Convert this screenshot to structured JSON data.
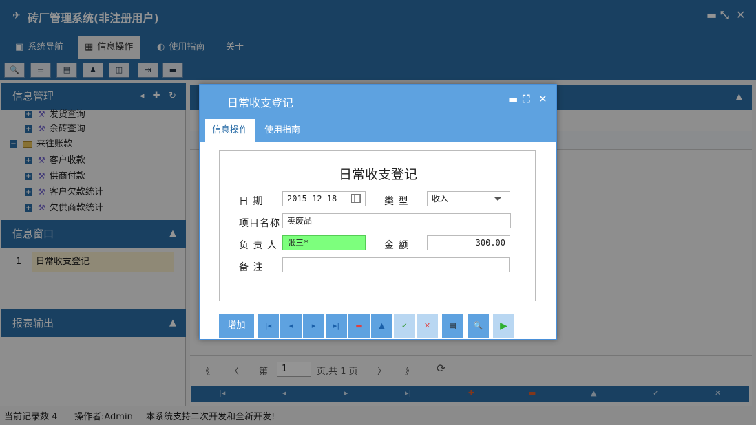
{
  "app": {
    "title": "砖厂管理系统(非注册用户)",
    "logo": "✈",
    "minimize": "▬",
    "restore": "⤡",
    "close": "✕"
  },
  "menu": {
    "nav": "系统导航",
    "info": "信息操作",
    "guide": "使用指南",
    "about": "关于"
  },
  "sidebar": {
    "info_mgmt": "信息管理",
    "items": [
      {
        "label": "发货查询"
      },
      {
        "label": "余砖查询"
      },
      {
        "label": "来往账款"
      },
      {
        "label": "客户收款"
      },
      {
        "label": "供商付款"
      },
      {
        "label": "客户欠款统计"
      },
      {
        "label": "欠供商款统计"
      }
    ],
    "win_panel": "信息窗口",
    "win_num": "1",
    "win_name": "日常收支登记",
    "report_panel": "报表输出"
  },
  "pager": {
    "first": "《",
    "prev": "〈",
    "page_prefix": "第",
    "page_value": "1",
    "page_suffix": "页,共 1 页",
    "next": "〉",
    "last": "》",
    "refresh": "⟳"
  },
  "status": {
    "records": "当前记录数 4",
    "operator": "操作者:Admin",
    "note": "本系统支持二次开发和全新开发!"
  },
  "dialog": {
    "title": "日常收支登记",
    "min": "▬",
    "max": "⛶",
    "close": "✕",
    "tab_info": "信息操作",
    "tab_guide": "使用指南",
    "form_title": "日常收支登记",
    "date_label": "日 期",
    "date_value": "2015-12-18",
    "type_label": "类 型",
    "type_value": "收入",
    "item_label": "项目名称",
    "item_value": "卖废品",
    "person_label": "负 责 人",
    "person_value": "张三*",
    "amount_label": "金 额",
    "amount_value": "300.00",
    "note_label": "备 注",
    "note_value": "",
    "add_btn": "增加"
  },
  "colors": {
    "primary": "#2b6ea8",
    "dialog_header": "#5ea2e0",
    "highlight_green": "#7dff7d"
  }
}
